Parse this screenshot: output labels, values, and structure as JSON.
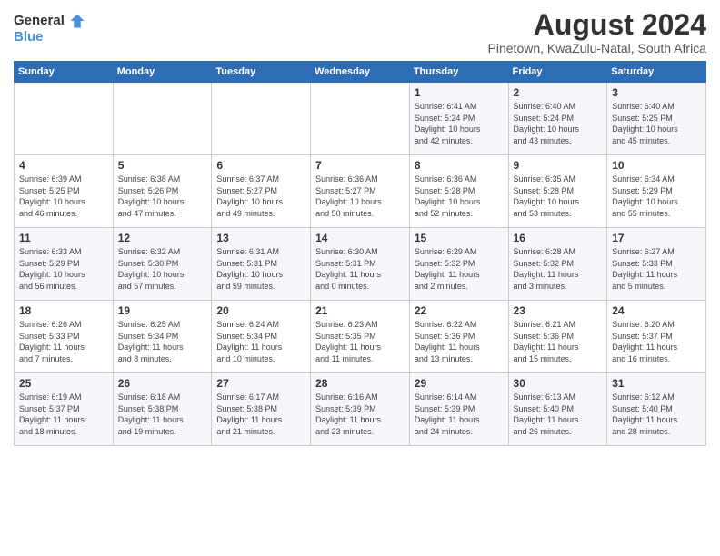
{
  "header": {
    "logo_general": "General",
    "logo_blue": "Blue",
    "title": "August 2024",
    "location": "Pinetown, KwaZulu-Natal, South Africa"
  },
  "calendar": {
    "weekdays": [
      "Sunday",
      "Monday",
      "Tuesday",
      "Wednesday",
      "Thursday",
      "Friday",
      "Saturday"
    ],
    "weeks": [
      [
        {
          "day": "",
          "info": ""
        },
        {
          "day": "",
          "info": ""
        },
        {
          "day": "",
          "info": ""
        },
        {
          "day": "",
          "info": ""
        },
        {
          "day": "1",
          "info": "Sunrise: 6:41 AM\nSunset: 5:24 PM\nDaylight: 10 hours\nand 42 minutes."
        },
        {
          "day": "2",
          "info": "Sunrise: 6:40 AM\nSunset: 5:24 PM\nDaylight: 10 hours\nand 43 minutes."
        },
        {
          "day": "3",
          "info": "Sunrise: 6:40 AM\nSunset: 5:25 PM\nDaylight: 10 hours\nand 45 minutes."
        }
      ],
      [
        {
          "day": "4",
          "info": "Sunrise: 6:39 AM\nSunset: 5:25 PM\nDaylight: 10 hours\nand 46 minutes."
        },
        {
          "day": "5",
          "info": "Sunrise: 6:38 AM\nSunset: 5:26 PM\nDaylight: 10 hours\nand 47 minutes."
        },
        {
          "day": "6",
          "info": "Sunrise: 6:37 AM\nSunset: 5:27 PM\nDaylight: 10 hours\nand 49 minutes."
        },
        {
          "day": "7",
          "info": "Sunrise: 6:36 AM\nSunset: 5:27 PM\nDaylight: 10 hours\nand 50 minutes."
        },
        {
          "day": "8",
          "info": "Sunrise: 6:36 AM\nSunset: 5:28 PM\nDaylight: 10 hours\nand 52 minutes."
        },
        {
          "day": "9",
          "info": "Sunrise: 6:35 AM\nSunset: 5:28 PM\nDaylight: 10 hours\nand 53 minutes."
        },
        {
          "day": "10",
          "info": "Sunrise: 6:34 AM\nSunset: 5:29 PM\nDaylight: 10 hours\nand 55 minutes."
        }
      ],
      [
        {
          "day": "11",
          "info": "Sunrise: 6:33 AM\nSunset: 5:29 PM\nDaylight: 10 hours\nand 56 minutes."
        },
        {
          "day": "12",
          "info": "Sunrise: 6:32 AM\nSunset: 5:30 PM\nDaylight: 10 hours\nand 57 minutes."
        },
        {
          "day": "13",
          "info": "Sunrise: 6:31 AM\nSunset: 5:31 PM\nDaylight: 10 hours\nand 59 minutes."
        },
        {
          "day": "14",
          "info": "Sunrise: 6:30 AM\nSunset: 5:31 PM\nDaylight: 11 hours\nand 0 minutes."
        },
        {
          "day": "15",
          "info": "Sunrise: 6:29 AM\nSunset: 5:32 PM\nDaylight: 11 hours\nand 2 minutes."
        },
        {
          "day": "16",
          "info": "Sunrise: 6:28 AM\nSunset: 5:32 PM\nDaylight: 11 hours\nand 3 minutes."
        },
        {
          "day": "17",
          "info": "Sunrise: 6:27 AM\nSunset: 5:33 PM\nDaylight: 11 hours\nand 5 minutes."
        }
      ],
      [
        {
          "day": "18",
          "info": "Sunrise: 6:26 AM\nSunset: 5:33 PM\nDaylight: 11 hours\nand 7 minutes."
        },
        {
          "day": "19",
          "info": "Sunrise: 6:25 AM\nSunset: 5:34 PM\nDaylight: 11 hours\nand 8 minutes."
        },
        {
          "day": "20",
          "info": "Sunrise: 6:24 AM\nSunset: 5:34 PM\nDaylight: 11 hours\nand 10 minutes."
        },
        {
          "day": "21",
          "info": "Sunrise: 6:23 AM\nSunset: 5:35 PM\nDaylight: 11 hours\nand 11 minutes."
        },
        {
          "day": "22",
          "info": "Sunrise: 6:22 AM\nSunset: 5:36 PM\nDaylight: 11 hours\nand 13 minutes."
        },
        {
          "day": "23",
          "info": "Sunrise: 6:21 AM\nSunset: 5:36 PM\nDaylight: 11 hours\nand 15 minutes."
        },
        {
          "day": "24",
          "info": "Sunrise: 6:20 AM\nSunset: 5:37 PM\nDaylight: 11 hours\nand 16 minutes."
        }
      ],
      [
        {
          "day": "25",
          "info": "Sunrise: 6:19 AM\nSunset: 5:37 PM\nDaylight: 11 hours\nand 18 minutes."
        },
        {
          "day": "26",
          "info": "Sunrise: 6:18 AM\nSunset: 5:38 PM\nDaylight: 11 hours\nand 19 minutes."
        },
        {
          "day": "27",
          "info": "Sunrise: 6:17 AM\nSunset: 5:38 PM\nDaylight: 11 hours\nand 21 minutes."
        },
        {
          "day": "28",
          "info": "Sunrise: 6:16 AM\nSunset: 5:39 PM\nDaylight: 11 hours\nand 23 minutes."
        },
        {
          "day": "29",
          "info": "Sunrise: 6:14 AM\nSunset: 5:39 PM\nDaylight: 11 hours\nand 24 minutes."
        },
        {
          "day": "30",
          "info": "Sunrise: 6:13 AM\nSunset: 5:40 PM\nDaylight: 11 hours\nand 26 minutes."
        },
        {
          "day": "31",
          "info": "Sunrise: 6:12 AM\nSunset: 5:40 PM\nDaylight: 11 hours\nand 28 minutes."
        }
      ]
    ]
  }
}
